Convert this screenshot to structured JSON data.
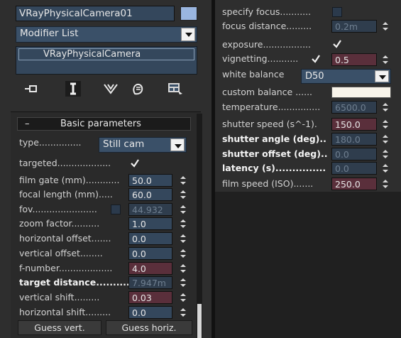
{
  "object": {
    "name": "VRayPhysicalCamera01",
    "color": "#9ab6e0"
  },
  "modifier_list": {
    "label": "Modifier List"
  },
  "stack": {
    "items": [
      "VRayPhysicalCamera"
    ]
  },
  "toolbar": {
    "icons": [
      "pin-stack-icon",
      "show-end-result-icon",
      "make-unique-icon",
      "remove-modifier-icon",
      "configure-modifier-sets-icon"
    ]
  },
  "rollout": {
    "collapse_symbol": "–",
    "title": "Basic parameters"
  },
  "basic": {
    "type_label": "type...............",
    "type_value": "Still cam",
    "targeted_label": "targeted...................",
    "targeted_checked": true,
    "film_gate": {
      "label": "film gate (mm)............",
      "value": "50.0"
    },
    "focal_length": {
      "label": "focal length (mm).....",
      "value": "60.0"
    },
    "fov": {
      "label": "fov.......................",
      "value": "44.932",
      "checked": false
    },
    "zoom_factor": {
      "label": "zoom factor..........",
      "value": "1.0"
    },
    "horizontal_offset": {
      "label": "horizontal offset.......",
      "value": "0.0"
    },
    "vertical_offset": {
      "label": "vertical offset........",
      "value": "0.0"
    },
    "f_number": {
      "label": "f-number...................",
      "value": "4.0"
    },
    "target_distance": {
      "label": "target distance..........",
      "value": "7.947m"
    },
    "vertical_shift": {
      "label": "vertical shift.........",
      "value": "0.03"
    },
    "horizontal_shift": {
      "label": "horizontal shift.........",
      "value": "0.0"
    },
    "guess_vert": "Guess vert.",
    "guess_horiz": "Guess horiz."
  },
  "right": {
    "specify_focus": {
      "label": "specify focus...........",
      "checked": false
    },
    "focus_distance": {
      "label": "focus distance.........",
      "value": "0.2m"
    },
    "exposure": {
      "label": "exposure.................",
      "checked": true
    },
    "vignetting": {
      "label": "vignetting...........",
      "checked": true,
      "value": "0.5"
    },
    "white_balance": {
      "label": "white balance",
      "value": "D50"
    },
    "custom_balance": {
      "label": "custom balance ......",
      "color": "#f8f4ea"
    },
    "temperature": {
      "label": "temperature...............",
      "value": "6500.0"
    },
    "shutter_speed": {
      "label": "shutter speed (s^-1).",
      "value": "150.0"
    },
    "shutter_angle": {
      "label": "shutter angle (deg)..",
      "value": "180.0"
    },
    "shutter_offset": {
      "label": "shutter offset (deg)..",
      "value": "0.0"
    },
    "latency": {
      "label": "latency (s)...............",
      "value": "0.0"
    },
    "film_speed": {
      "label": "film speed (ISO).......",
      "value": "250.0"
    }
  }
}
